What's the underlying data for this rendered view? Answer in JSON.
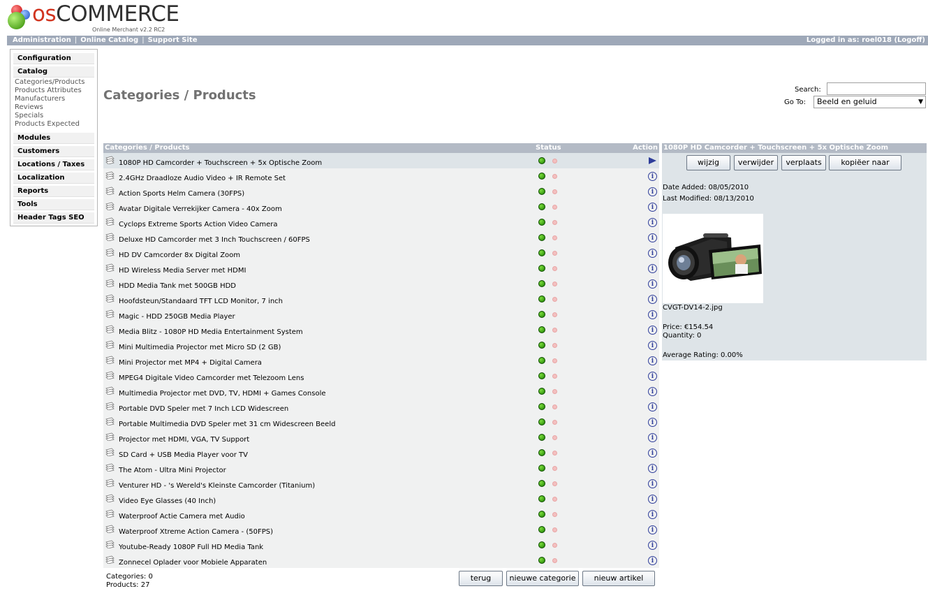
{
  "logo": {
    "word_os": "os",
    "word_rest": "COMMERCE",
    "subtitle": "Online Merchant v2.2 RC2"
  },
  "topbar": {
    "links": [
      "Administration",
      "Online Catalog",
      "Support Site"
    ],
    "separator": "|",
    "logged_in": "Logged in as: roel018 (Logoff)"
  },
  "sidebar": {
    "configuration": "Configuration",
    "catalog": "Catalog",
    "catalog_items": [
      "Categories/Products",
      "Products Attributes",
      "Manufacturers",
      "Reviews",
      "Specials",
      "Products Expected"
    ],
    "sections": [
      "Modules",
      "Customers",
      "Locations / Taxes",
      "Localization",
      "Reports",
      "Tools",
      "Header Tags SEO"
    ]
  },
  "page": {
    "title": "Categories / Products",
    "search_label": "Search:",
    "search_value": "",
    "goto_label": "Go To:",
    "goto_value": "Beeld en geluid"
  },
  "table": {
    "headers": {
      "name": "Categories / Products",
      "status": "Status",
      "action": "Action"
    },
    "products": [
      "1080P HD Camcorder + Touchscreen + 5x Optische Zoom",
      "2.4GHz Draadloze Audio Video + IR Remote Set",
      "Action Sports Helm Camera (30FPS)",
      "Avatar Digitale Verrekijker Camera - 40x Zoom",
      "Cyclops Extreme Sports Action Video Camera",
      "Deluxe HD Camcorder met 3 Inch Touchscreen / 60FPS",
      "HD DV Camcorder 8x Digital Zoom",
      "HD Wireless Media Server met HDMI",
      "HDD Media Tank met 500GB HDD",
      "Hoofdsteun/Standaard TFT LCD Monitor, 7 inch",
      "Magic - HDD 250GB Media Player",
      "Media Blitz - 1080P HD Media Entertainment System",
      "Mini Multimedia Projector met Micro SD (2 GB)",
      "Mini Projector met MP4 + Digital Camera",
      "MPEG4 Digitale Video Camcorder met Telezoom Lens",
      "Multimedia Projector met DVD, TV, HDMI + Games Console",
      "Portable DVD Speler met 7 Inch LCD Widescreen",
      "Portable Multimedia DVD Speler met 31 cm Widescreen Beeld",
      "Projector met HDMI, VGA, TV Support",
      "SD Card + USB Media Player voor TV",
      "The Atom - Ultra Mini Projector",
      "Venturer HD - 's Wereld's Kleinste Camcorder (Titanium)",
      "Video Eye Glasses (40 Inch)",
      "Waterproof Actie Camera met Audio",
      "Waterproof Xtreme Action Camera - (50FPS)",
      "Youtube-Ready 1080P Full HD Media Tank",
      "Zonnecel Oplader voor Mobiele Apparaten"
    ],
    "selected_index": 0,
    "info_glyph": "i",
    "counts_categories": "Categories: 0",
    "counts_products": "Products: 27",
    "buttons": {
      "back": "terug",
      "new_category": "nieuwe categorie",
      "new_product": "nieuw artikel"
    }
  },
  "infobox": {
    "heading": "1080P HD Camcorder + Touchscreen + 5x Optische Zoom",
    "buttons": {
      "edit": "wijzig",
      "delete": "verwijder",
      "move": "verplaats",
      "copy": "kopiëer naar"
    },
    "date_added": "Date Added: 08/05/2010",
    "last_modified": "Last Modified: 08/13/2010",
    "image_filename": "CVGT-DV14-2.jpg",
    "price": "Price: €154.54",
    "quantity": "Quantity: 0",
    "rating": "Average Rating: 0.00%"
  },
  "colors": {
    "bar": "#9ea8b8",
    "table_head": "#b3bac5",
    "row_bg": "#f0f1f1",
    "selected_bg": "#dee4e8",
    "status_on": "#1a7d00",
    "status_off": "#f3c0c0",
    "icon_blue": "#2e3d9a"
  },
  "icons": {
    "logo": "oscommerce-balls-icon",
    "row": "product-preview-icon",
    "status_on": "status-green-icon",
    "status_off": "status-red-icon",
    "action": "info-icon",
    "selected_action": "arrow-right-icon",
    "dropdown": "chevron-down-icon"
  }
}
